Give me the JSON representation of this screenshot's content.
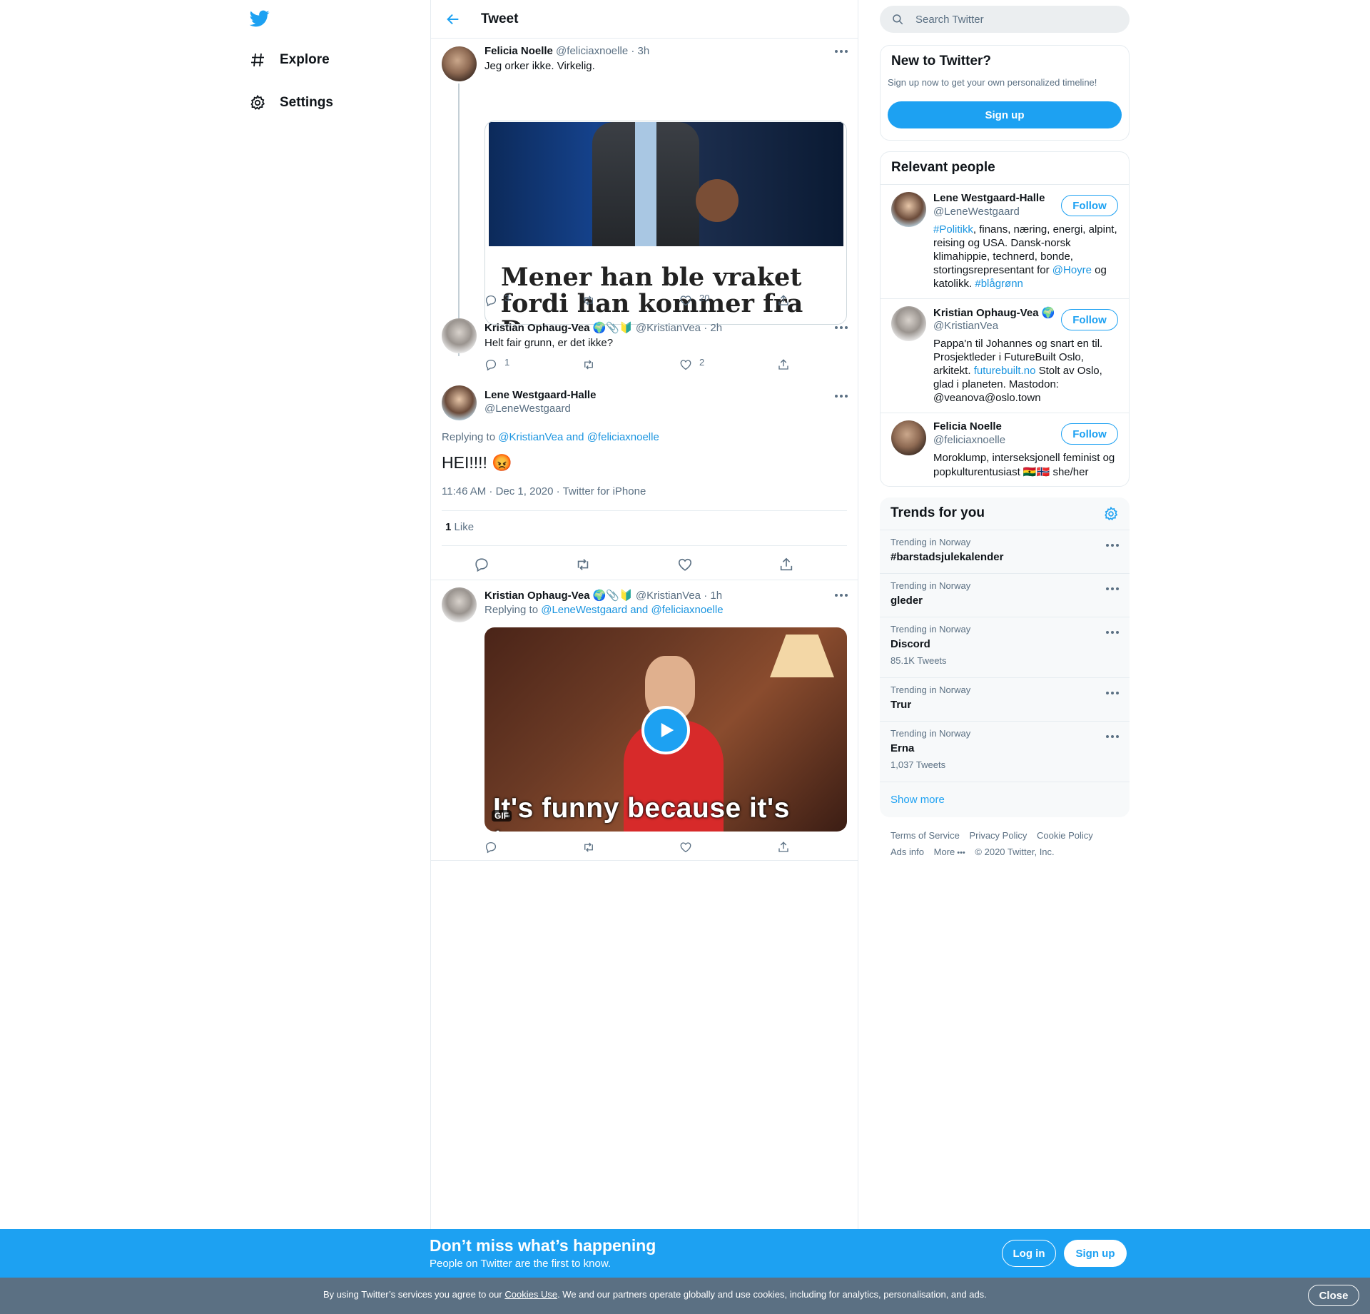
{
  "nav": {
    "items": [
      {
        "label": "Explore",
        "icon": "hashtag-icon"
      },
      {
        "label": "Settings",
        "icon": "gear-icon"
      }
    ]
  },
  "header": {
    "title": "Tweet"
  },
  "tweets": {
    "t1": {
      "name": "Felicia Noelle",
      "handle": "@feliciaxnoelle",
      "time": "· 3h",
      "text": "Jeg orker ikke. Virkelig.",
      "card_headline": "Mener han ble vraket fordi han kommer fra Drammen",
      "replies": "3",
      "likes": "20"
    },
    "t2": {
      "name": "Kristian Ophaug-Vea",
      "emojis": "🌍📎🔰",
      "handle": "@KristianVea",
      "time": "· 2h",
      "text": "Helt fair grunn, er det ikke?",
      "replies": "1",
      "likes": "2"
    },
    "main": {
      "name": "Lene Westgaard-Halle",
      "handle": "@LeneWestgaard",
      "replying_prefix": "Replying to",
      "reply_to_1": "@KristianVea",
      "reply_and": "and",
      "reply_to_2": "@feliciaxnoelle",
      "text": "HEI!!!!",
      "emoji": "😡",
      "time": "11:46 AM · Dec 1, 2020",
      "source": "Twitter for iPhone",
      "like_count": "1",
      "like_label": "Like"
    },
    "t3": {
      "name": "Kristian Ophaug-Vea",
      "emojis": "🌍📎🔰",
      "handle": "@KristianVea",
      "time": "· 1h",
      "replying_prefix": "Replying to",
      "reply_to_1": "@LeneWestgaard",
      "reply_and": "and",
      "reply_to_2": "@feliciaxnoelle",
      "gif_caption": "It's funny because it's true",
      "gif_badge": "GIF"
    }
  },
  "search": {
    "placeholder": "Search Twitter"
  },
  "new_to_twitter": {
    "title": "New to Twitter?",
    "subtitle": "Sign up now to get your own personalized timeline!",
    "button": "Sign up"
  },
  "relevant": {
    "title": "Relevant people",
    "follow_label": "Follow",
    "people": [
      {
        "name": "Lene Westgaard-Halle",
        "handle": "@LeneWestgaard",
        "bio_1": "#Politikk",
        "bio_2": ", finans, næring, energi, alpint, reising og USA. Dansk-norsk klimahippie, technerd, bonde, stortingsrepresentant for ",
        "bio_3": "@Hoyre",
        "bio_4": " og katolikk. ",
        "bio_5": "#blågrønn"
      },
      {
        "name": "Kristian Ophaug-Vea",
        "emoji": "🌍",
        "handle": "@KristianVea",
        "bio_1": "Pappa'n til Johannes og snart en til. Prosjektleder i FutureBuilt Oslo, arkitekt. ",
        "bio_2": "futurebuilt.no",
        "bio_3": " Stolt av Oslo, glad i planeten. Mastodon: @veanova@oslo.town"
      },
      {
        "name": "Felicia Noelle",
        "handle": "@feliciaxnoelle",
        "bio_1": "Moroklump, interseksjonell feminist og popkulturentusiast",
        "flags": "🇬🇭🇳🇴",
        "bio_2": " she/her"
      }
    ]
  },
  "trends": {
    "title": "Trends for you",
    "items": [
      {
        "meta": "Trending in Norway",
        "name": "#barstadsjulekalender",
        "count": ""
      },
      {
        "meta": "Trending in Norway",
        "name": "gleder",
        "count": ""
      },
      {
        "meta": "Trending in Norway",
        "name": "Discord",
        "count": "85.1K Tweets"
      },
      {
        "meta": "Trending in Norway",
        "name": "Trur",
        "count": ""
      },
      {
        "meta": "Trending in Norway",
        "name": "Erna",
        "count": "1,037 Tweets"
      }
    ],
    "show_more": "Show more"
  },
  "footer": {
    "links": [
      "Terms of Service",
      "Privacy Policy",
      "Cookie Policy",
      "Ads info",
      "More"
    ],
    "copyright": "© 2020 Twitter, Inc."
  },
  "banner": {
    "title": "Don’t miss what’s happening",
    "subtitle": "People on Twitter are the first to know.",
    "login": "Log in",
    "signup": "Sign up"
  },
  "cookie": {
    "text_1": "By using Twitter’s services you agree to our ",
    "link": "Cookies Use",
    "text_2": ". We and our partners operate globally and use cookies, including for analytics, personalisation, and ads.",
    "close": "Close"
  },
  "colors": {
    "accent": "#1da1f2",
    "link": "#1b95e0",
    "secondary_text": "#5b7083",
    "cookie_bar": "#5b7083"
  }
}
